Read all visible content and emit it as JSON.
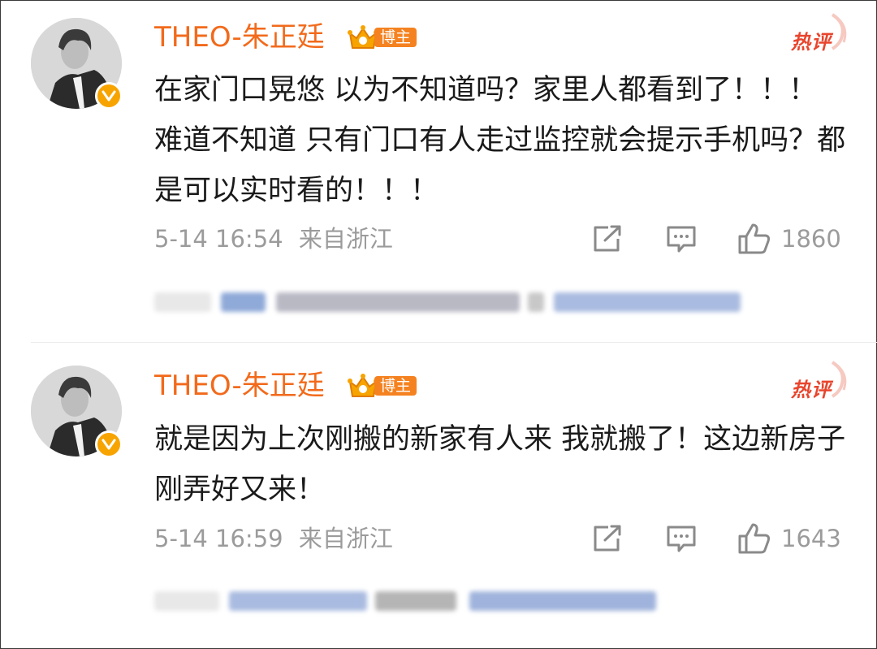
{
  "hot_label": "热评",
  "badge_label": "博主",
  "comments": [
    {
      "username": "THEO-朱正廷",
      "text": "在家门口晃悠 以为不知道吗？家里人都看到了！！！  难道不知道 只有门口有人走过监控就会提示手机吗？都是可以实时看的！！！",
      "date": "5-14 16:54",
      "location": "来自浙江",
      "likes": "1860"
    },
    {
      "username": "THEO-朱正廷",
      "text": "就是因为上次刚搬的新家有人来 我就搬了！这边新房子刚弄好又来！",
      "date": "5-14 16:59",
      "location": "来自浙江",
      "likes": "1643"
    }
  ],
  "colors": {
    "username": "#f26a1b",
    "badge": "#f58220",
    "hot": "#e8452d",
    "meta": "#9b9b9b",
    "verified": "#f7a400"
  }
}
